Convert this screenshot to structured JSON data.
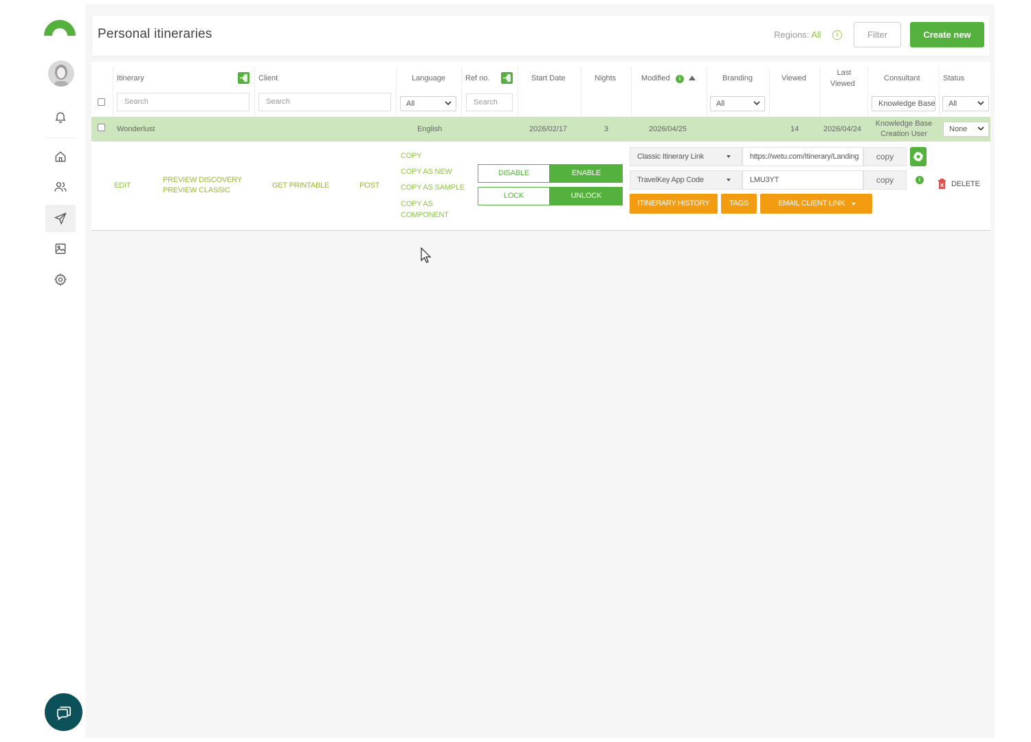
{
  "header": {
    "title": "Personal itineraries",
    "regions_label": "Regions:",
    "regions_value": "All",
    "filter_label": "Filter",
    "create_label": "Create new"
  },
  "table": {
    "columns": {
      "itinerary": "Itinerary",
      "client": "Client",
      "language": "Language",
      "ref_no": "Ref no.",
      "start_date": "Start Date",
      "nights": "Nights",
      "modified": "Modified",
      "branding": "Branding",
      "viewed": "Viewed",
      "last_viewed_1": "Last",
      "last_viewed_2": "Viewed",
      "consultant": "Consultant",
      "status": "Status"
    },
    "filters": {
      "itinerary_placeholder": "Search",
      "client_placeholder": "Search",
      "language_value": "All",
      "ref_placeholder": "Search",
      "branding_value": "All",
      "consultant_value": "Knowledge Base",
      "status_value": "All"
    },
    "rows": [
      {
        "itinerary": "Wonderlust",
        "client": "",
        "language": "English",
        "ref_no": "",
        "start_date": "2026/02/17",
        "nights": "3",
        "modified": "2026/04/25",
        "branding": "",
        "viewed": "14",
        "last_viewed": "2026/04/24",
        "consultant_1": "Knowledge Base",
        "consultant_2": "Creation User",
        "status": "None"
      }
    ]
  },
  "actions": {
    "edit": "EDIT",
    "preview_discovery": "PREVIEW DISCOVERY",
    "preview_classic": "PREVIEW CLASSIC",
    "get_printable": "GET PRINTABLE",
    "post": "POST",
    "copy": "COPY",
    "copy_as_new": "COPY AS NEW",
    "copy_as_sample": "COPY AS SAMPLE",
    "copy_as_component_1": "COPY AS",
    "copy_as_component_2": "COMPONENT",
    "disable": "DISABLE",
    "enable": "ENABLE",
    "lock": "LOCK",
    "unlock": "UNLOCK",
    "link_type": "Classic Itinerary Link",
    "link_url": "https://wetu.com/Itinerary/Landing",
    "code_type": "TravelKey App Code",
    "code_value": "LMU3YT",
    "copy_btn": "copy",
    "itinerary_history": "ITINERARY HISTORY",
    "tags": "TAGS",
    "email_client_link": "EMAIL CLIENT LINK",
    "delete": "DELETE"
  },
  "colors": {
    "brand_green": "#55b13e",
    "row_highlight": "#cde6be",
    "orange": "#f39c12",
    "chat": "#0c5059"
  }
}
